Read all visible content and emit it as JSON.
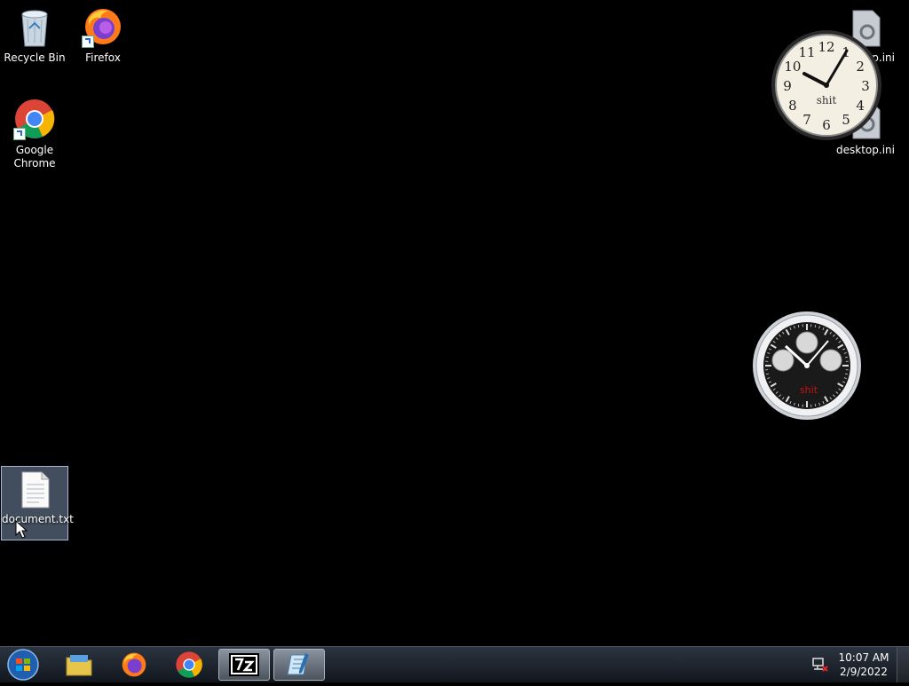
{
  "desktop": {
    "icons": [
      {
        "label": "Recycle Bin"
      },
      {
        "label": "Firefox"
      },
      {
        "label": "Google Chrome"
      },
      {
        "label": "document.txt"
      },
      {
        "label": "desktop.ini"
      },
      {
        "label": "desktop.ini"
      }
    ]
  },
  "gadgets": {
    "clock": {
      "label": "shit",
      "numerals": [
        "12",
        "1",
        "2",
        "3",
        "4",
        "5",
        "6",
        "7",
        "8",
        "9",
        "10",
        "11"
      ],
      "time": "10:07"
    },
    "chronograph": {
      "label": "shit"
    }
  },
  "taskbar": {
    "start": "start-button",
    "pinned": [
      "windows-explorer",
      "firefox",
      "google-chrome",
      "7-zip",
      "notepad"
    ],
    "time": "10:07 AM",
    "date": "2/9/2022"
  },
  "colors": {
    "desktop_bg": "#000000",
    "chrono_label": "#d01010"
  }
}
